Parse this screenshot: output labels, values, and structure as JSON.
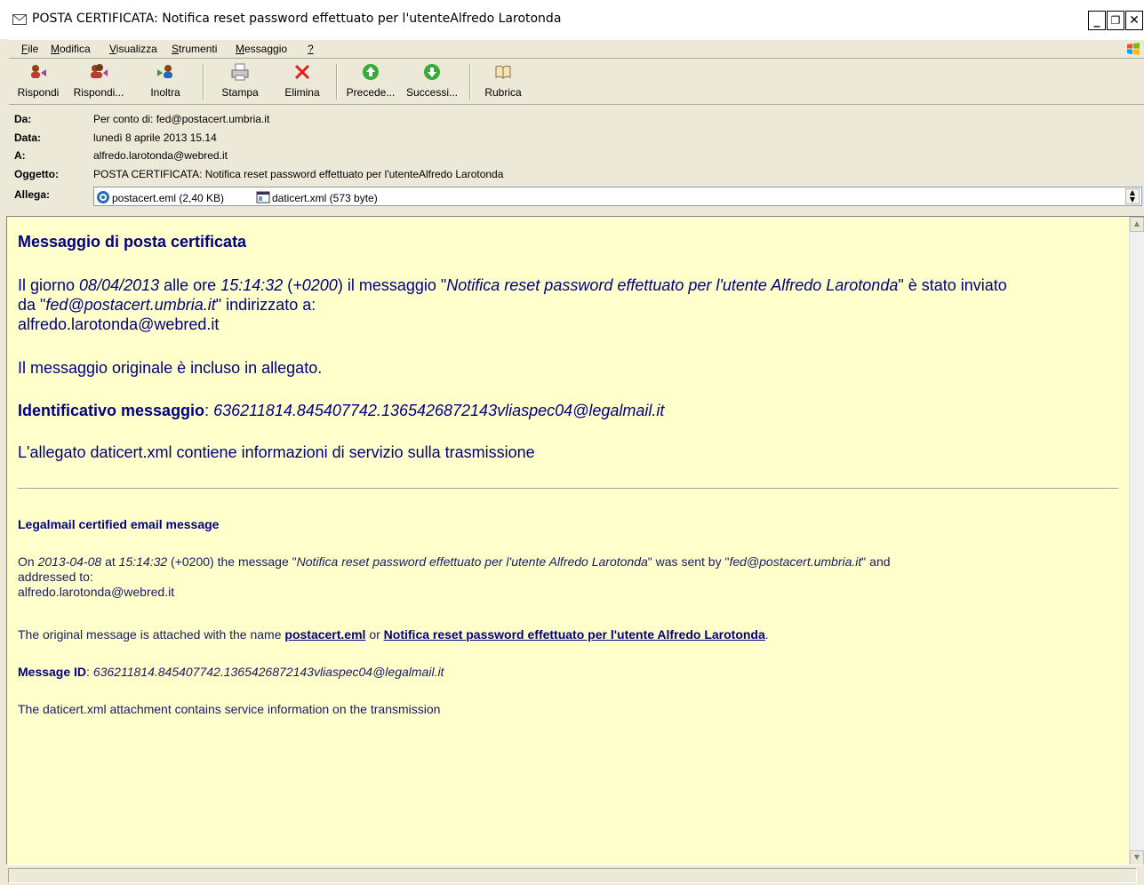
{
  "window": {
    "title": "POSTA CERTIFICATA: Notifica reset password effettuato per l'utenteAlfredo Larotonda",
    "minimize": "_",
    "restore": "❐",
    "close": "✕"
  },
  "menu": [
    {
      "label": "File",
      "u": "F",
      "rest": "ile"
    },
    {
      "label": "Modifica",
      "u": "M",
      "rest": "odifica"
    },
    {
      "label": "Visualizza",
      "u": "V",
      "rest": "isualizza"
    },
    {
      "label": "Strumenti",
      "u": "S",
      "rest": "trumenti"
    },
    {
      "label": "Messaggio",
      "u": "M",
      "rest": "essaggio"
    },
    {
      "label": "?",
      "u": "?",
      "rest": ""
    }
  ],
  "toolbar": {
    "reply": "Rispondi",
    "reply_all": "Rispondi...",
    "forward": "Inoltra",
    "print": "Stampa",
    "delete": "Elimina",
    "previous": "Precede...",
    "next": "Successi...",
    "address_book": "Rubrica"
  },
  "headers": {
    "from_label": "Da:",
    "from_value": "Per conto di: fed@postacert.umbria.it",
    "date_label": "Data:",
    "date_value": "lunedì 8 aprile 2013 15.14",
    "to_label": "A:",
    "to_value": "alfredo.larotonda@webred.it",
    "subject_label": "Oggetto:",
    "subject_value": "POSTA CERTIFICATA: Notifica reset password effettuato per l'utenteAlfredo Larotonda",
    "attach_label": "Allega:",
    "attachments": [
      {
        "name": "postacert.eml (2,40 KB)",
        "icon": "eml-icon"
      },
      {
        "name": "daticert.xml (573 byte)",
        "icon": "xml-icon"
      }
    ]
  },
  "body": {
    "it_heading": "Messaggio di posta certificata",
    "it_p1_a": "Il giorno ",
    "it_p1_date": "08/04/2013",
    "it_p1_b": " alle ore ",
    "it_p1_time": "15:14:32",
    "it_p1_c": " (",
    "it_p1_tz": "+0200",
    "it_p1_d": ") il messaggio \"",
    "it_p1_subject": "Notifica reset password effettuato per l'utente Alfredo Larotonda",
    "it_p1_e": "\" è stato inviato",
    "it_p1_f": "da \"",
    "it_p1_sender": "fed@postacert.umbria.it",
    "it_p1_g": "\" indirizzato a:",
    "it_p1_recipient": "alfredo.larotonda@webred.it",
    "it_p2": "Il messaggio originale è incluso in allegato.",
    "it_id_label": "Identificativo messaggio",
    "it_id_sep": ": ",
    "it_id_value": "636211814.845407742.1365426872143vliaspec04@legalmail.it",
    "it_p4": "L'allegato daticert.xml contiene informazioni di servizio sulla trasmissione",
    "en_heading": "Legalmail certified email message",
    "en_p1_a": "On ",
    "en_p1_date": "2013-04-08",
    "en_p1_b": " at ",
    "en_p1_time": "15:14:32",
    "en_p1_c": " (+0200) the message \"",
    "en_p1_subject": "Notifica reset password effettuato per l'utente Alfredo Larotonda",
    "en_p1_d": "\" was sent by \"",
    "en_p1_sender": "fed@postacert.umbria.it",
    "en_p1_e": "\" and",
    "en_p1_f": "addressed to:",
    "en_p1_recipient": "alfredo.larotonda@webred.it",
    "en_p2_a": "The original message is attached with the name ",
    "en_p2_link1": "postacert.eml",
    "en_p2_b": " or ",
    "en_p2_link2": "Notifica reset password effettuato per l'utente Alfredo Larotonda",
    "en_p2_c": ".",
    "en_id_label": "Message ID",
    "en_id_sep": ": ",
    "en_id_value": "636211814.845407742.1365426872143vliaspec04@legalmail.it",
    "en_p4": "The daticert.xml attachment contains service information on the transmission"
  },
  "colors": {
    "body_bg": "#FFFFCC",
    "text_navy": "#000080"
  }
}
